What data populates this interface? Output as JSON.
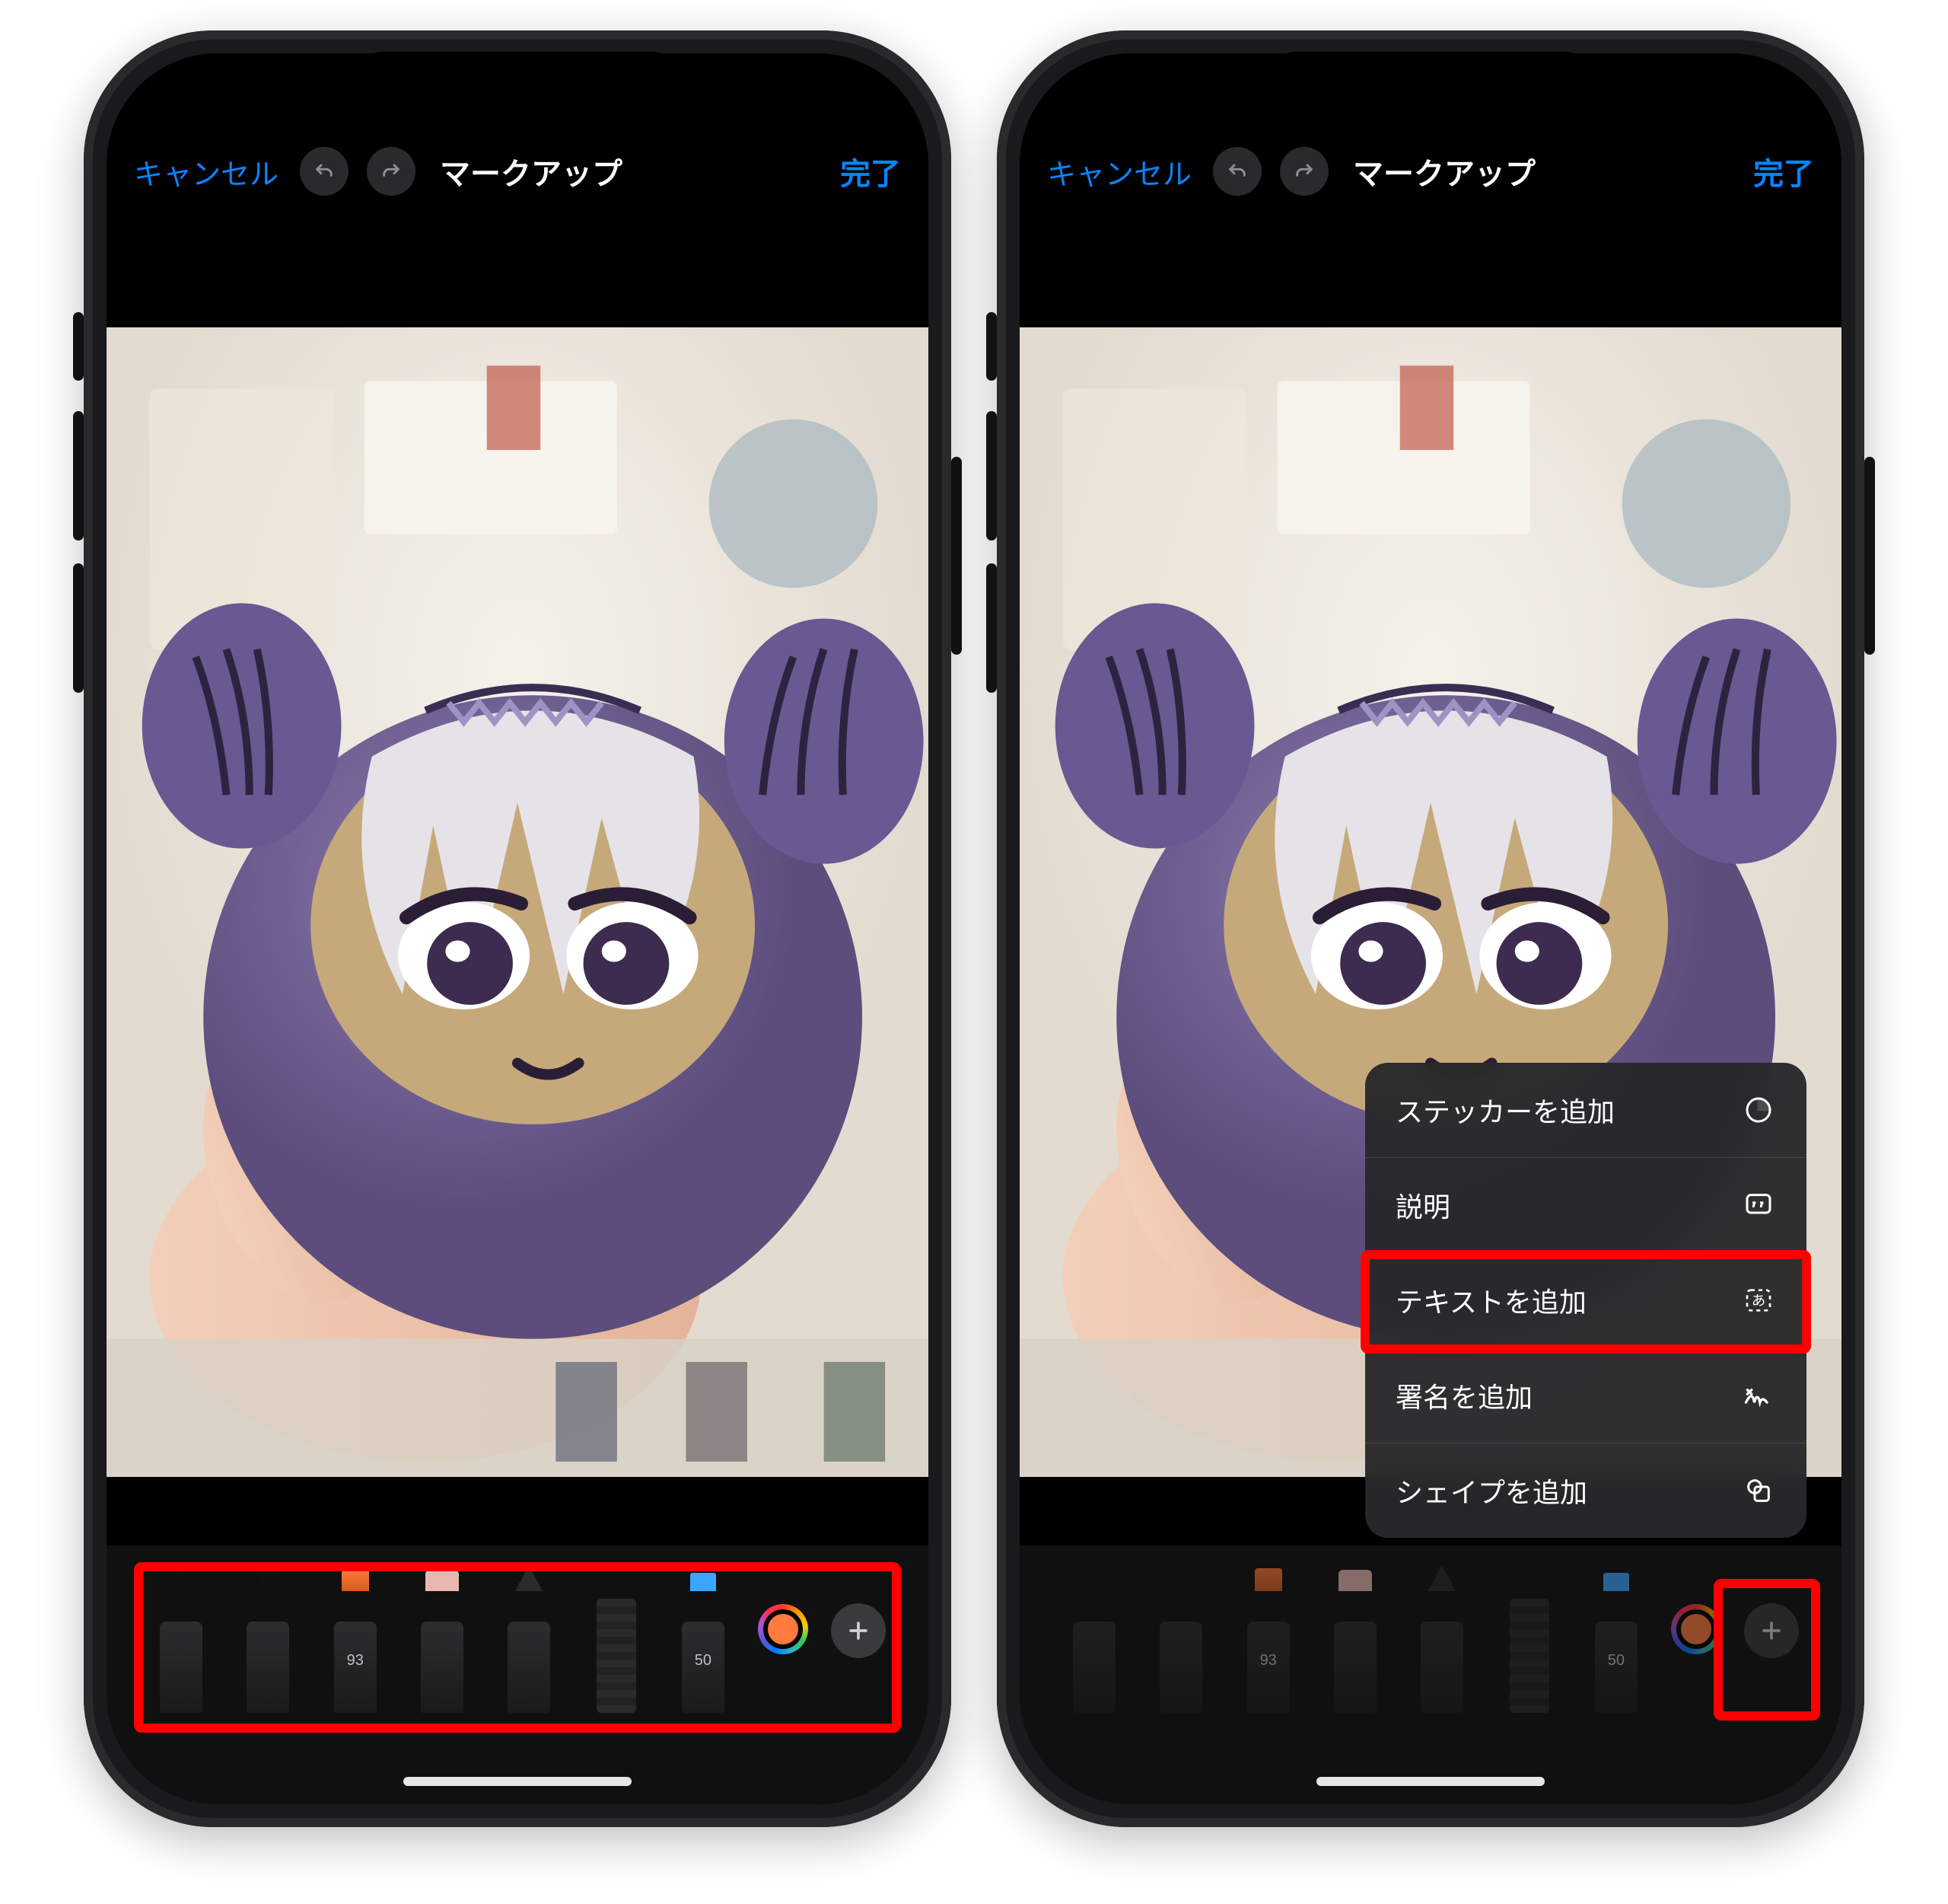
{
  "nav": {
    "cancel": "キャンセル",
    "title": "マークアップ",
    "done": "完了"
  },
  "tools": {
    "marker_number": "93",
    "highlighter_number": "50"
  },
  "menu": {
    "items": [
      {
        "label": "ステッカーを追加",
        "icon": "sticker-icon"
      },
      {
        "label": "説明",
        "icon": "quote-icon"
      },
      {
        "label": "テキストを追加",
        "icon": "text-icon"
      },
      {
        "label": "署名を追加",
        "icon": "signature-icon"
      },
      {
        "label": "シェイプを追加",
        "icon": "shape-icon"
      }
    ]
  },
  "colors": {
    "ios_blue": "#0a84ff",
    "highlight": "#ff0000",
    "selected_color": "#ff7a3c"
  }
}
